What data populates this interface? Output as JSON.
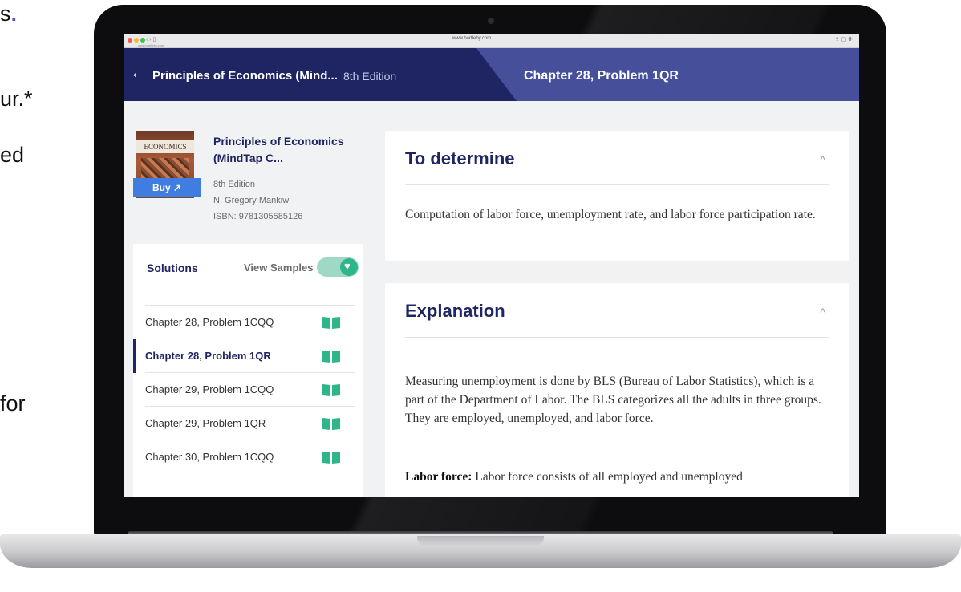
{
  "slide_fragments": [
    "s",
    ".",
    "ur.*",
    "ed",
    "for"
  ],
  "browser": {
    "url": "www.bartleby.com",
    "url_small": "www.bartleby.com",
    "nav_glyphs": "‹ › ▯",
    "right_glyphs": "⇪ ▢ ✚"
  },
  "header": {
    "back_arrow": "←",
    "book_title": "Principles of Economics (Mind...",
    "edition": "8th Edition",
    "chapter_problem": "Chapter 28, Problem 1QR"
  },
  "book": {
    "cover_label": "ECONOMICS",
    "buy_label": "Buy ↗",
    "name": "Principles of Economics (MindTap C...",
    "edition": "8th Edition",
    "author": "N. Gregory Mankiw",
    "isbn": "ISBN: 9781305585126"
  },
  "solutions": {
    "title": "Solutions",
    "view_samples_label": "View Samples",
    "view_samples_on": true,
    "items": [
      {
        "label": "Chapter 28, Problem 1CQQ",
        "active": false
      },
      {
        "label": "Chapter 28, Problem 1QR",
        "active": true
      },
      {
        "label": "Chapter 29, Problem 1CQQ",
        "active": false
      },
      {
        "label": "Chapter 29, Problem 1QR",
        "active": false
      },
      {
        "label": "Chapter 30, Problem 1CQQ",
        "active": false
      }
    ]
  },
  "to_determine": {
    "heading": "To determine",
    "chevron": "^",
    "text": "Computation of labor force, unemployment rate, and labor force participation rate."
  },
  "explanation": {
    "heading": "Explanation",
    "chevron": "^",
    "paragraph": "Measuring unemployment is done by BLS (Bureau of Labor Statistics), which is a part of the Department of Labor. The BLS categorizes all the adults in three groups. They are employed, unemployed, and labor force.",
    "labor_force_term": "Labor force:",
    "labor_force_text": "Labor force consists of all employed and unemployed"
  },
  "colors": {
    "header_dark": "#1f2563",
    "header_light": "#454f9a",
    "buy_button": "#3f7de0",
    "toggle_on": "#2eb589",
    "book_icon": "#2eb589",
    "accent_dot": "#5b4de0"
  }
}
